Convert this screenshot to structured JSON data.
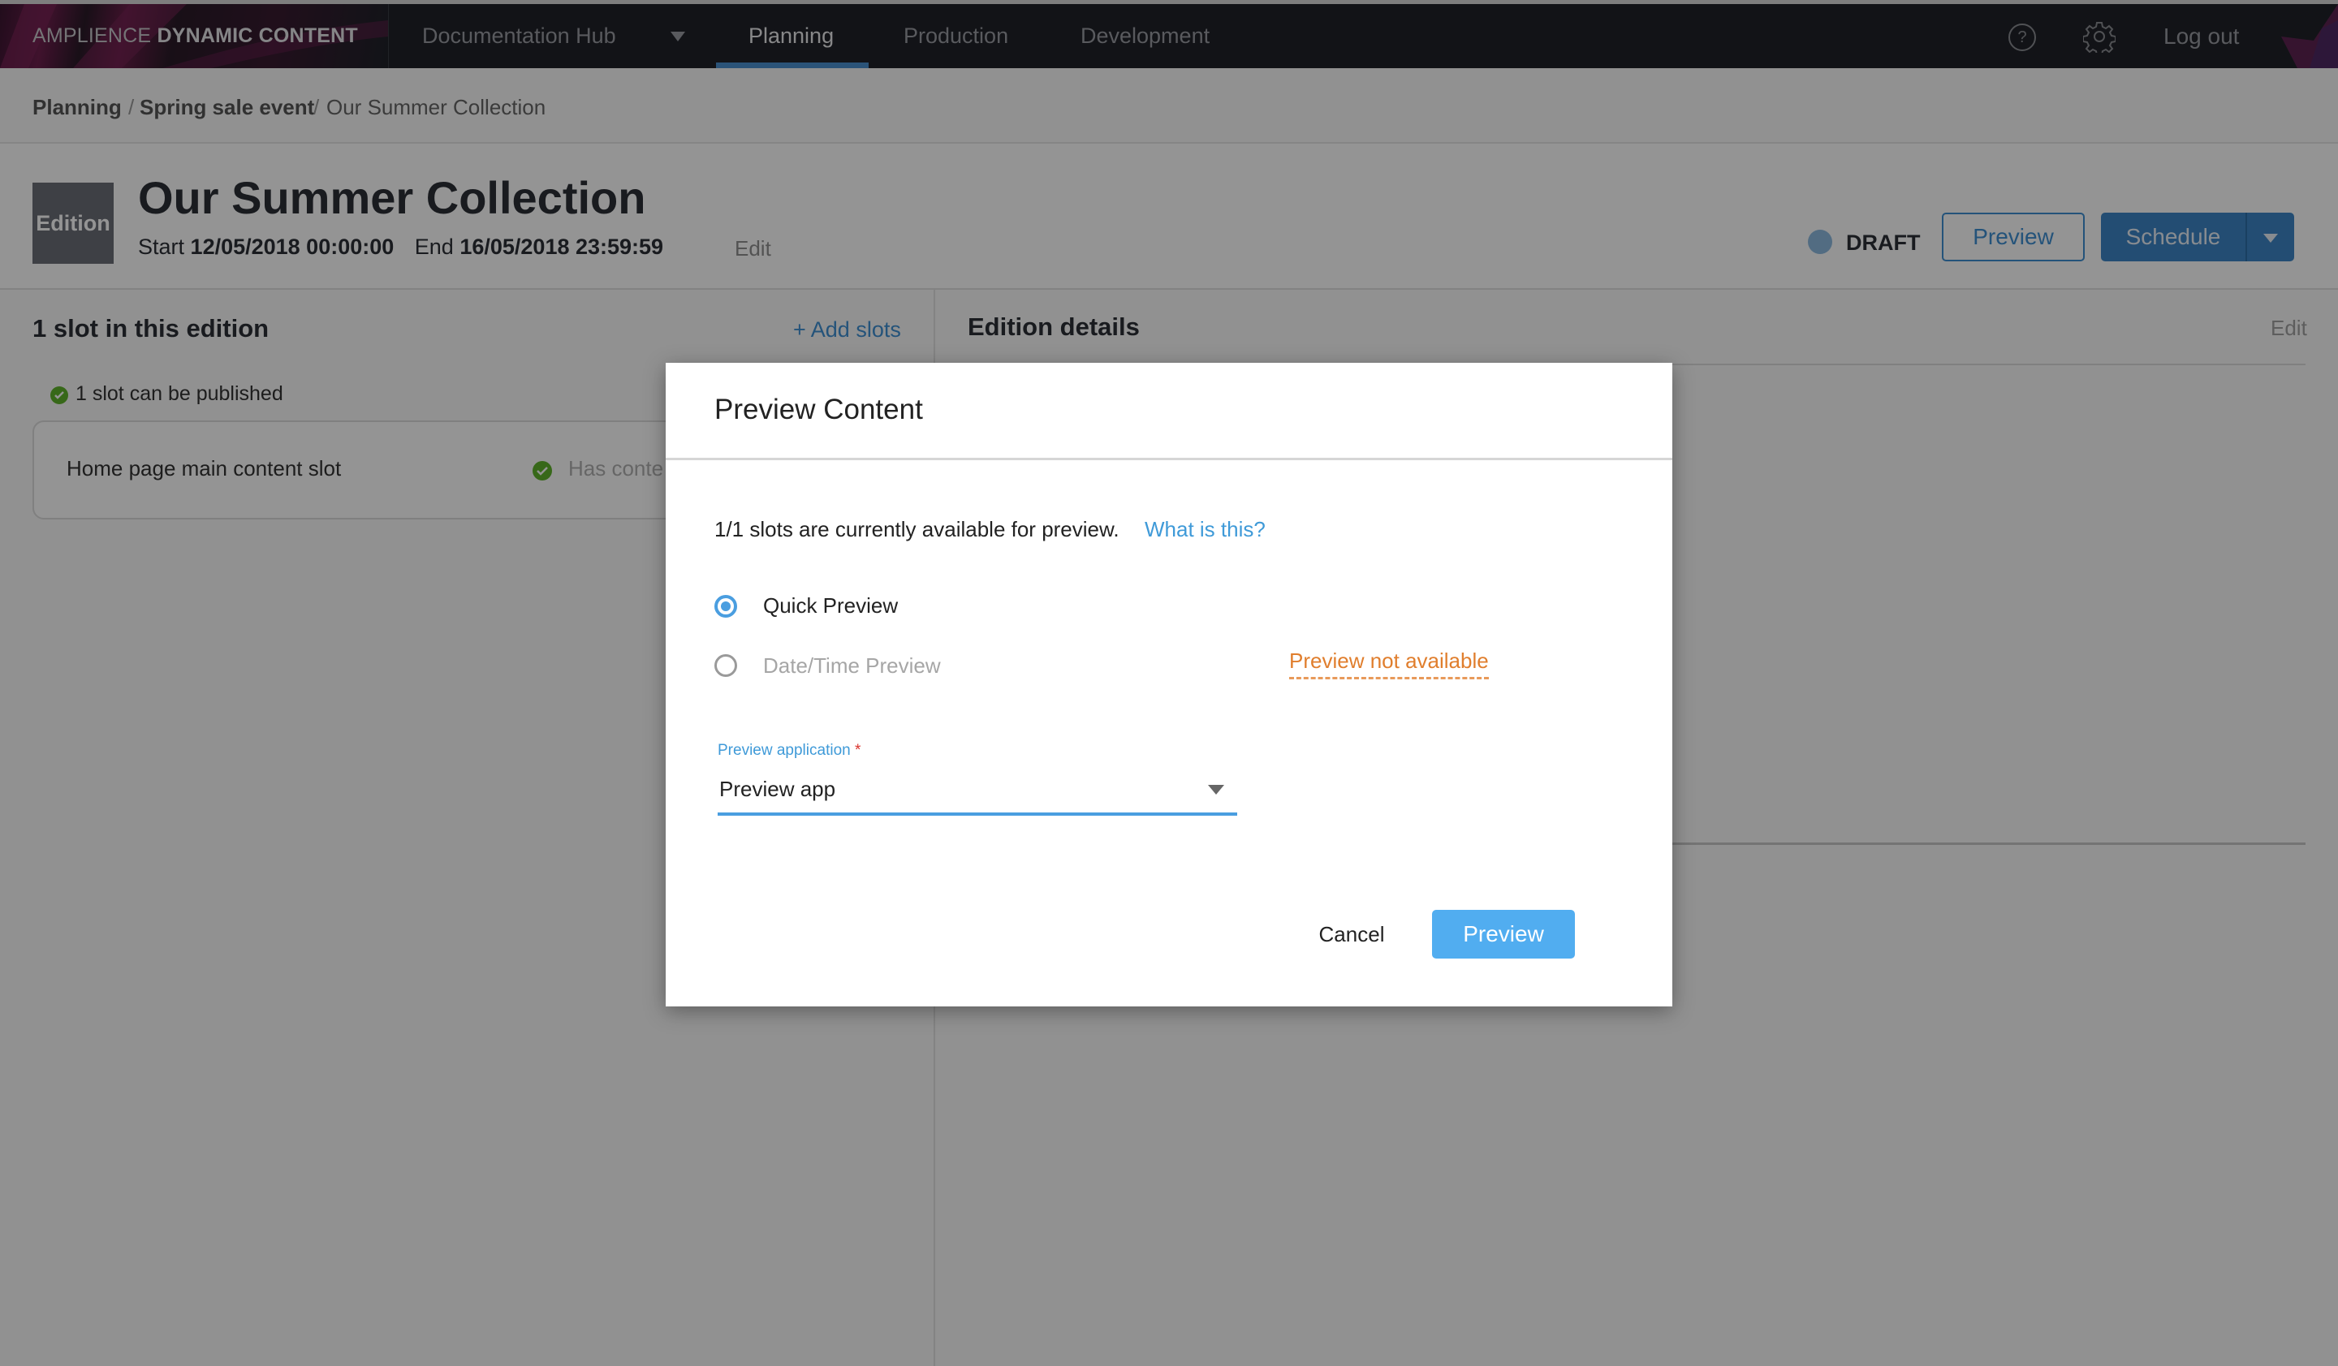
{
  "app": {
    "brand_light": "AMPLIENCE",
    "brand_bold": "DYNAMIC CONTENT"
  },
  "nav": {
    "hub": "Documentation Hub",
    "tabs": [
      {
        "label": "Planning",
        "active": true
      },
      {
        "label": "Production",
        "active": false
      },
      {
        "label": "Development",
        "active": false
      }
    ],
    "help_icon": "help-circle-icon",
    "settings_icon": "gear-icon",
    "logout": "Log out"
  },
  "breadcrumb": {
    "items": [
      "Planning",
      "Spring sale event",
      "Our Summer Collection"
    ],
    "separator": "/"
  },
  "edition": {
    "badge": "Edition",
    "title": "Our Summer Collection",
    "start_label": "Start",
    "start_value": "12/05/2018 00:00:00",
    "end_label": "End",
    "end_value": "16/05/2018 23:59:59",
    "edit_label": "Edit",
    "status": "DRAFT",
    "preview_button": "Preview",
    "schedule_button": "Schedule"
  },
  "slots_panel": {
    "title": "1 slot in this edition",
    "add_slots": "+ Add slots",
    "publish_status": "1 slot can be published",
    "slots": [
      {
        "name": "Home page main content slot",
        "status": "Has conte"
      }
    ]
  },
  "details_panel": {
    "title": "Edition details",
    "edit_label": "Edit"
  },
  "modal": {
    "title": "Preview Content",
    "availability_text": "1/1 slots are currently available for preview.",
    "what_is_this": "What is this?",
    "options": [
      {
        "label": "Quick Preview",
        "selected": true,
        "enabled": true
      },
      {
        "label": "Date/Time Preview",
        "selected": false,
        "enabled": false
      }
    ],
    "not_available": "Preview not available",
    "field_label": "Preview application",
    "required_mark": "*",
    "selected_app": "Preview app",
    "cancel": "Cancel",
    "confirm": "Preview"
  },
  "colors": {
    "accent": "#3f8fd2",
    "primary_button": "#51adf0",
    "warning": "#e07e2d",
    "success": "#5fb32c",
    "nav_bg": "#1f2229"
  }
}
